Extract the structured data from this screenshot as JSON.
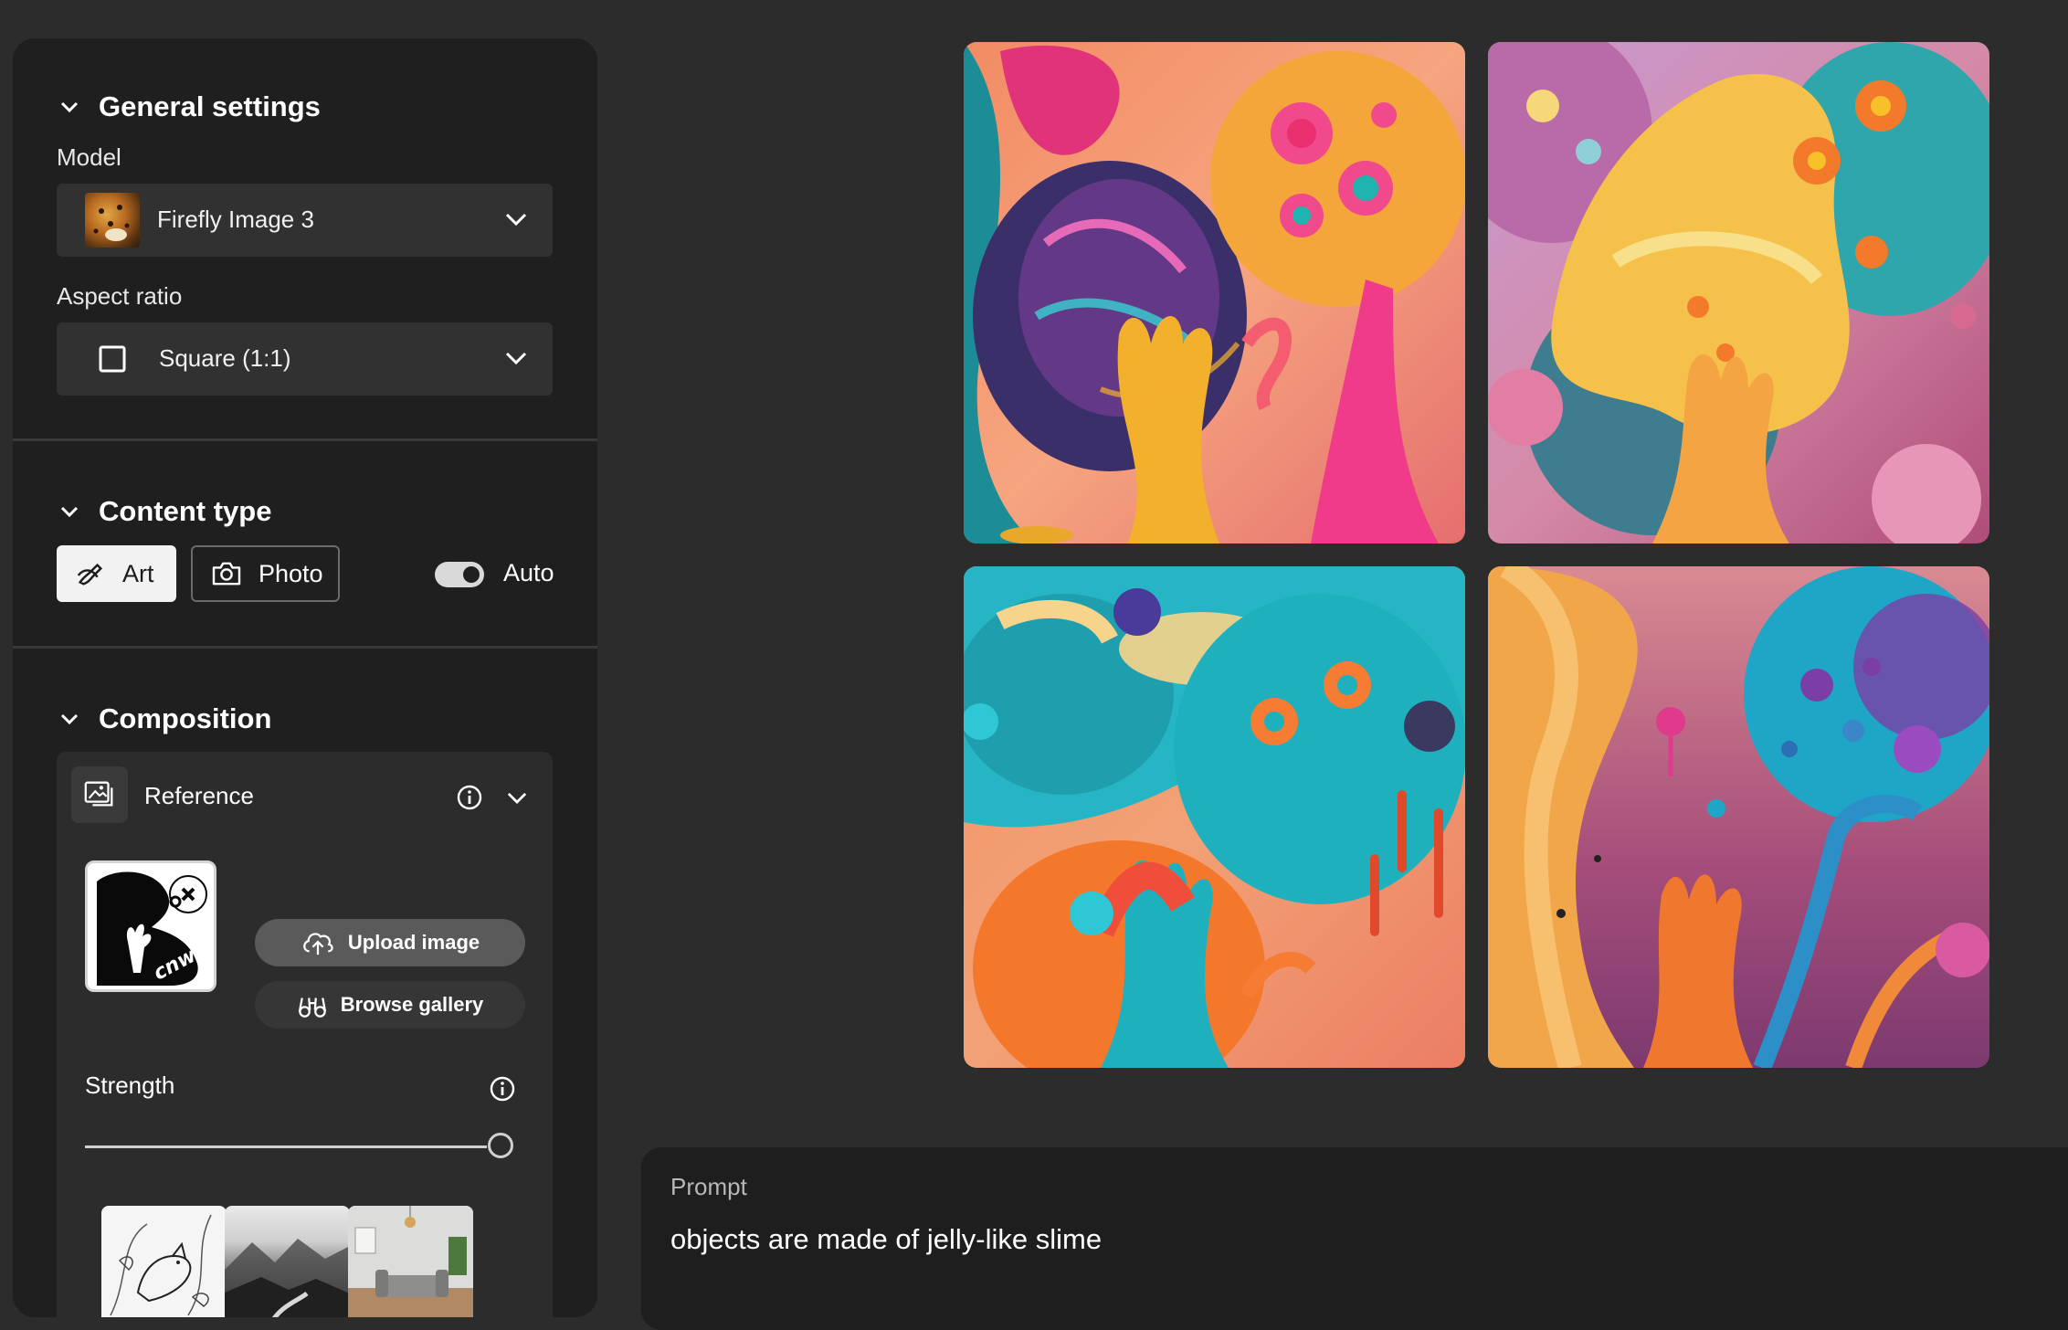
{
  "sidebar": {
    "general_settings": {
      "title": "General settings",
      "model_label": "Model",
      "model_value": "Firefly Image 3",
      "aspect_label": "Aspect ratio",
      "aspect_value": "Square (1:1)"
    },
    "content_type": {
      "title": "Content type",
      "art_label": "Art",
      "photo_label": "Photo",
      "auto_label": "Auto",
      "selected": "Art",
      "auto_on": true
    },
    "composition": {
      "title": "Composition",
      "reference_label": "Reference",
      "upload_label": "Upload image",
      "browse_label": "Browse gallery",
      "strength_label": "Strength",
      "strength_value": 1.0,
      "style_thumbnails": [
        "line-art-bird",
        "misty-mountains",
        "living-room"
      ]
    }
  },
  "gallery": {
    "images": [
      "jelly-slime-1",
      "jelly-slime-2",
      "jelly-slime-3",
      "jelly-slime-4"
    ]
  },
  "prompt": {
    "label": "Prompt",
    "text": "objects are made of jelly-like slime"
  },
  "colors": {
    "background": "#2c2c2c",
    "panel": "#1f1f1f",
    "selected_button": "#f2f2f2"
  }
}
